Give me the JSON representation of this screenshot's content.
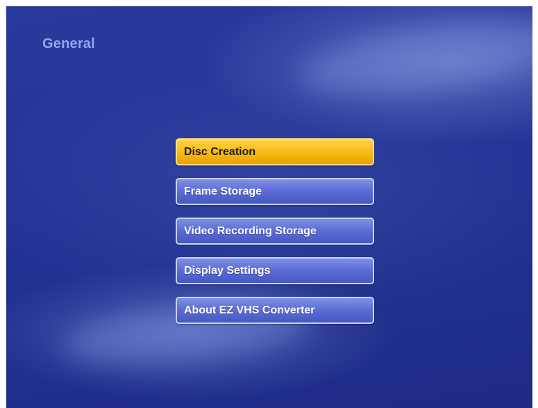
{
  "page": {
    "title": "General"
  },
  "menu": {
    "items": [
      {
        "label": "Disc Creation",
        "selected": true
      },
      {
        "label": "Frame Storage",
        "selected": false
      },
      {
        "label": "Video Recording Storage",
        "selected": false
      },
      {
        "label": "Display Settings",
        "selected": false
      },
      {
        "label": "About EZ VHS Converter",
        "selected": false
      }
    ]
  },
  "colors": {
    "background": "#24338f",
    "title_text": "#8fa9ec",
    "button_blue": "#5d6fd6",
    "button_selected": "#f7b90f"
  }
}
